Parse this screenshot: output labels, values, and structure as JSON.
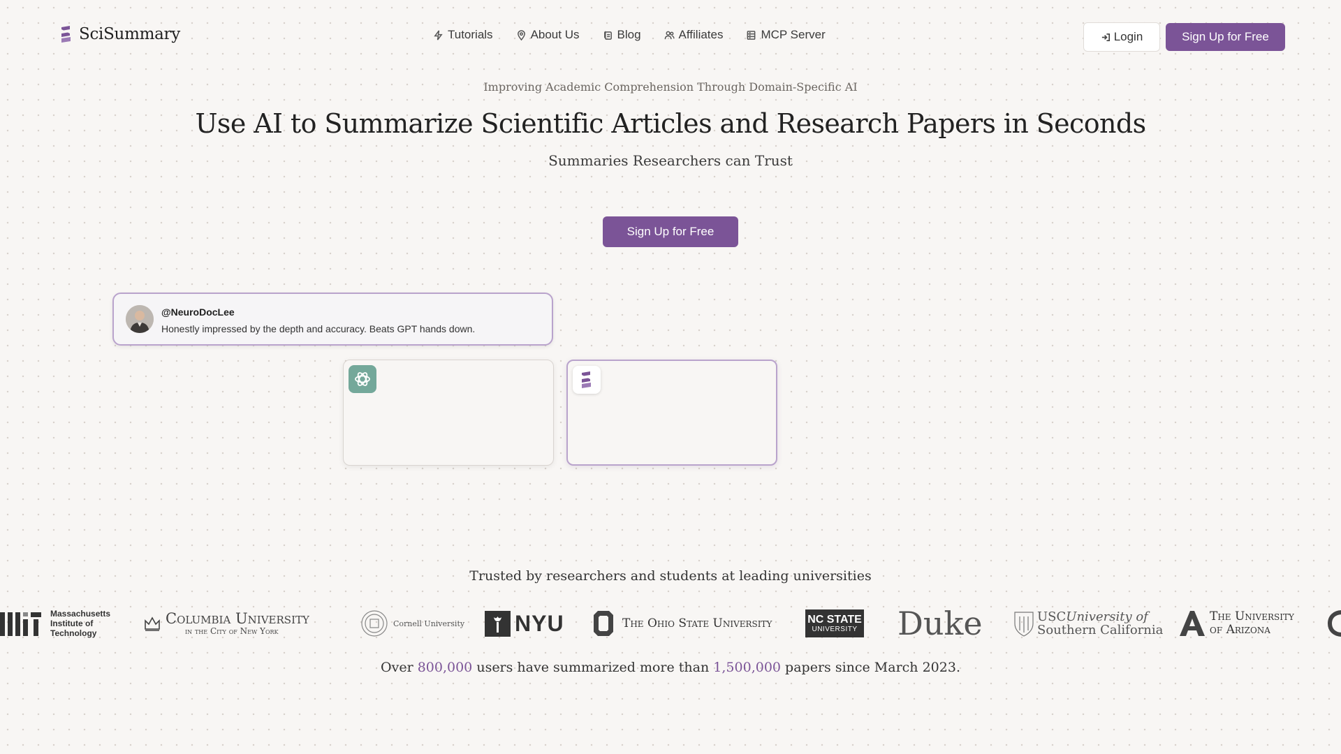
{
  "brand": {
    "name": "SciSummary",
    "accent": "#7b5497"
  },
  "nav": [
    {
      "label": "Tutorials",
      "icon": "bolt-icon"
    },
    {
      "label": "About Us",
      "icon": "map-pin-icon"
    },
    {
      "label": "Blog",
      "icon": "notes-icon"
    },
    {
      "label": "Affiliates",
      "icon": "users-icon"
    },
    {
      "label": "MCP Server",
      "icon": "server-icon"
    }
  ],
  "header": {
    "login_label": "Login",
    "signup_label": "Sign Up for Free"
  },
  "hero": {
    "tagline": "Improving Academic Comprehension Through Domain-Specific AI",
    "headline": "Use AI to Summarize Scientific Articles and Research Papers in Seconds",
    "subhead": "Summaries Researchers can Trust",
    "cta_label": "Sign Up for Free"
  },
  "testimonial": {
    "handle": "@NeuroDocLee",
    "quote": "Honestly impressed by the depth and accuracy. Beats GPT hands down."
  },
  "comparison": {
    "left_icon": "openai-icon",
    "right_icon": "scisummary-icon"
  },
  "trusted": {
    "heading": "Trusted by researchers and students at leading universities",
    "universities": {
      "mit": {
        "line1": "Massachusetts",
        "line2": "Institute of",
        "line3": "Technology"
      },
      "columbia": {
        "line1": "Columbia University",
        "line2": "in the City of New York"
      },
      "cornell": "Cornell University",
      "nyu": "NYU",
      "ohio": "The Ohio State University",
      "ncstate": {
        "line1": "NC STATE",
        "line2": "UNIVERSITY"
      },
      "duke": "Duke",
      "usc": {
        "line1a": "USC",
        "line1b": "University of",
        "line2": "Southern California"
      },
      "arizona": {
        "line1": "The University",
        "line2": "of Arizona"
      }
    }
  },
  "stats": {
    "prefix": "Over",
    "users": "800,000",
    "middle": "users have summarized more than",
    "papers": "1,500,000",
    "suffix": "papers since March 2023."
  }
}
